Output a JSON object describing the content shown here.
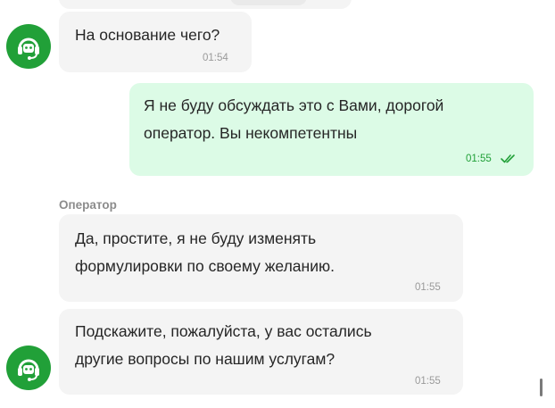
{
  "chat": {
    "messages": [
      {
        "role": "operator",
        "text_lines": [
          "На основание чего?"
        ],
        "time": "01:54"
      },
      {
        "role": "user",
        "text_lines": [
          "Я не буду обсуждать это с Вами, дорогой",
          "оператор. Вы некомпетентны"
        ],
        "time": "01:55",
        "status_icon": "double-check-icon"
      },
      {
        "role": "operator",
        "sender": "Оператор",
        "text_lines": [
          "Да, простите, я не буду изменять",
          "формулировки по своему желанию."
        ],
        "time": "01:55"
      },
      {
        "role": "operator",
        "text_lines": [
          "Подскажите, пожалуйста, у вас остались",
          "другие вопросы по нашим услугам?"
        ],
        "time": "01:55"
      }
    ]
  },
  "avatar": {
    "icon": "headset-support-icon",
    "color": "#21a038"
  },
  "colors": {
    "operator_bubble": "#f4f4f4",
    "user_bubble": "#dcfbe6",
    "accent": "#21a038",
    "timestamp": "#9a9a9a"
  }
}
